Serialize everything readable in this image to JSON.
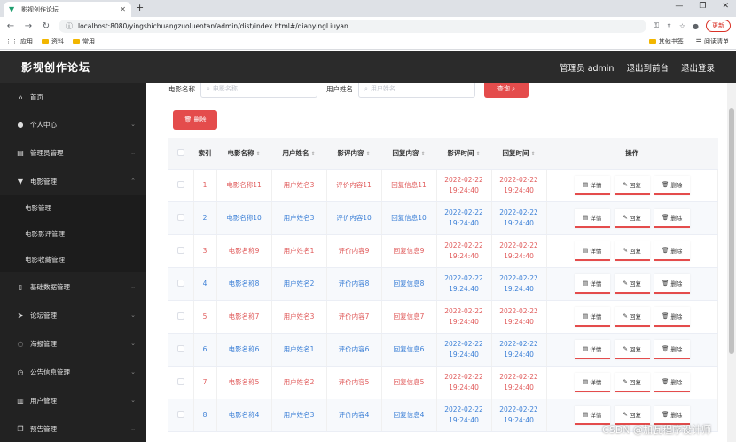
{
  "browser": {
    "tab_title": "影视创作论坛",
    "url": "localhost:8080/yingshichuangzuoluentan/admin/dist/index.html#/dianyingLiuyan",
    "update_label": "更新",
    "bookmarks": [
      "应用",
      "资料",
      "常用"
    ],
    "bookmarks_right": [
      "其他书签",
      "阅读清单"
    ]
  },
  "header": {
    "logo": "影视创作论坛",
    "admin": "管理员 admin",
    "exit_front": "退出到前台",
    "logout": "退出登录"
  },
  "sidebar": {
    "items": [
      {
        "label": "首页",
        "icon": "home-icon"
      },
      {
        "label": "个人中心",
        "icon": "user-icon"
      },
      {
        "label": "管理员管理",
        "icon": "list-icon"
      },
      {
        "label": "电影管理",
        "icon": "film-icon"
      }
    ],
    "sub_items": [
      "电影管理",
      "电影影评管理",
      "电影收藏管理"
    ],
    "items2": [
      {
        "label": "基础数据管理",
        "icon": "phone-icon"
      },
      {
        "label": "论坛管理",
        "icon": "send-icon"
      },
      {
        "label": "海报管理",
        "icon": "image-icon"
      },
      {
        "label": "公告信息管理",
        "icon": "clock-icon"
      },
      {
        "label": "用户管理",
        "icon": "chart-icon"
      },
      {
        "label": "预告管理",
        "icon": "copy-icon"
      }
    ]
  },
  "search": {
    "movie_label": "电影名称",
    "movie_placeholder": "电影名称",
    "user_label": "用户姓名",
    "user_placeholder": "用户姓名",
    "search_btn": "查询",
    "delete_btn": "删除"
  },
  "table": {
    "headers": [
      "索引",
      "电影名称",
      "用户姓名",
      "影评内容",
      "回复内容",
      "影评时间",
      "回复时间",
      "操作"
    ],
    "ops": [
      "详情",
      "回复",
      "删除"
    ],
    "rows": [
      {
        "idx": "1",
        "movie": "电影名称11",
        "user": "用户姓名3",
        "review": "评价内容11",
        "reply": "回复信息11",
        "rdate": "2022-02-22",
        "rtime": "19:24:40",
        "pdate": "2022-02-22",
        "ptime": "19:24:40"
      },
      {
        "idx": "2",
        "movie": "电影名称10",
        "user": "用户姓名3",
        "review": "评价内容10",
        "reply": "回复信息10",
        "rdate": "2022-02-22",
        "rtime": "19:24:40",
        "pdate": "2022-02-22",
        "ptime": "19:24:40"
      },
      {
        "idx": "3",
        "movie": "电影名称9",
        "user": "用户姓名1",
        "review": "评价内容9",
        "reply": "回复信息9",
        "rdate": "2022-02-22",
        "rtime": "19:24:40",
        "pdate": "2022-02-22",
        "ptime": "19:24:40"
      },
      {
        "idx": "4",
        "movie": "电影名称8",
        "user": "用户姓名2",
        "review": "评价内容8",
        "reply": "回复信息8",
        "rdate": "2022-02-22",
        "rtime": "19:24:40",
        "pdate": "2022-02-22",
        "ptime": "19:24:40"
      },
      {
        "idx": "5",
        "movie": "电影名称7",
        "user": "用户姓名3",
        "review": "评价内容7",
        "reply": "回复信息7",
        "rdate": "2022-02-22",
        "rtime": "19:24:40",
        "pdate": "2022-02-22",
        "ptime": "19:24:40"
      },
      {
        "idx": "6",
        "movie": "电影名称6",
        "user": "用户姓名1",
        "review": "评价内容6",
        "reply": "回复信息6",
        "rdate": "2022-02-22",
        "rtime": "19:24:40",
        "pdate": "2022-02-22",
        "ptime": "19:24:40"
      },
      {
        "idx": "7",
        "movie": "电影名称5",
        "user": "用户姓名2",
        "review": "评价内容5",
        "reply": "回复信息5",
        "rdate": "2022-02-22",
        "rtime": "19:24:40",
        "pdate": "2022-02-22",
        "ptime": "19:24:40"
      },
      {
        "idx": "8",
        "movie": "电影名称4",
        "user": "用户姓名3",
        "review": "评价内容4",
        "reply": "回复信息4",
        "rdate": "2022-02-22",
        "rtime": "19:24:40",
        "pdate": "2022-02-22",
        "ptime": "19:24:40"
      }
    ]
  },
  "watermark": "CSDN @加瓦程序设计师",
  "colors": {
    "accent": "#e44c4c",
    "sidebar": "#222222",
    "topbar": "#2b2b2b",
    "link_blue": "#3b7fd6"
  }
}
